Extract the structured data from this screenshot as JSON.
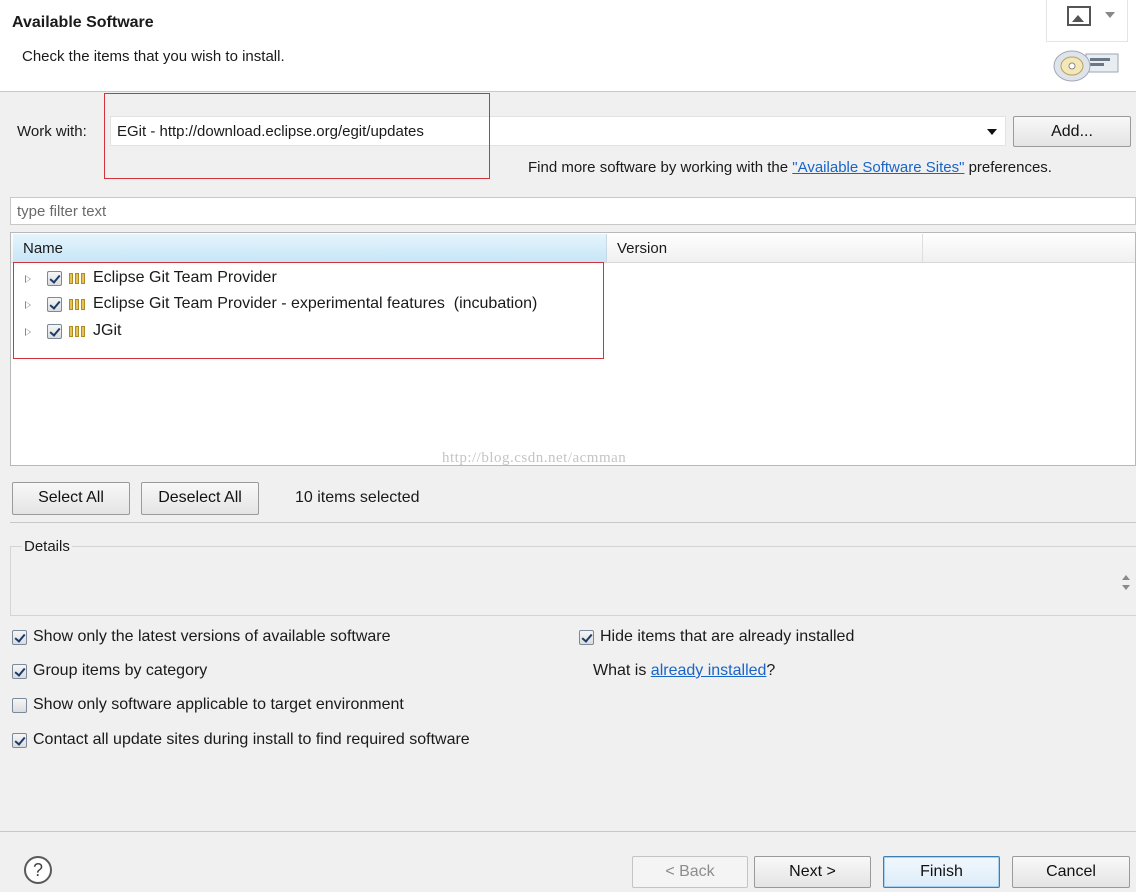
{
  "header": {
    "title": "Available Software",
    "subtitle": "Check the items that you wish to install.",
    "image_menu_icon": "image-menu-icon",
    "wizard_icon": "cd-install-icon"
  },
  "work_with": {
    "label": "Work with:",
    "value": "EGit - http://download.eclipse.org/egit/updates",
    "add_button": "Add...",
    "hint_prefix": "Find more software by working with the ",
    "hint_link": "\"Available Software Sites\"",
    "hint_suffix": " preferences."
  },
  "filter": {
    "placeholder": "type filter text"
  },
  "tree": {
    "columns": [
      "Name",
      "Version"
    ],
    "items": [
      {
        "label": "Eclipse Git Team Provider",
        "checked": true,
        "version": ""
      },
      {
        "label": "Eclipse Git Team Provider - experimental features  (incubation)",
        "checked": true,
        "version": ""
      },
      {
        "label": "JGit",
        "checked": true,
        "version": ""
      }
    ]
  },
  "watermark": "http://blog.csdn.net/acmman",
  "selection": {
    "select_all": "Select All",
    "deselect_all": "Deselect All",
    "count_text": "10 items selected"
  },
  "details": {
    "label": "Details"
  },
  "options": {
    "latest_versions": {
      "label": "Show only the latest versions of available software",
      "checked": true
    },
    "group_by_category": {
      "label": "Group items by category",
      "checked": true
    },
    "target_env": {
      "label": "Show only software applicable to target environment",
      "checked": false
    },
    "contact_sites": {
      "label": "Contact all update sites during install to find required software",
      "checked": true
    },
    "hide_installed": {
      "label": "Hide items that are already installed",
      "checked": true
    },
    "what_is_prefix": "What is ",
    "what_is_link": "already installed",
    "what_is_suffix": "?"
  },
  "footer": {
    "help": "?",
    "back": "< Back",
    "next": "Next >",
    "finish": "Finish",
    "cancel": "Cancel"
  },
  "colors": {
    "highlight_box": "#d0343a",
    "link": "#1a64c8",
    "header_column_selected": "#c6e6f8"
  }
}
